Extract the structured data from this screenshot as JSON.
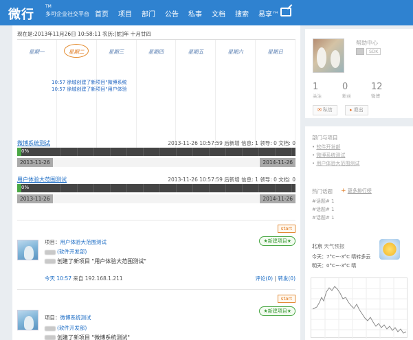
{
  "header": {
    "logo": "微行",
    "logo_tm": "TM",
    "logo_sub": "多可企业社交平台",
    "nav": [
      "首页",
      "项目",
      "部门",
      "公告",
      "私事",
      "文档",
      "搜索",
      "易享™"
    ]
  },
  "calendar": {
    "current_time": "现在是:2013年11月26日 10:58:11 农历:[蛇]年 十月廿四",
    "days": [
      "星期一",
      "星期二",
      "星期三",
      "星期四",
      "星期五",
      "星期六",
      "星期日"
    ],
    "active_index": 1,
    "events": [
      "10:57 徐城创建了新项目\"微博系统测试\"",
      "10:57 徐城创建了新项目\"用户体验大范围测试\""
    ]
  },
  "projects": [
    {
      "name": "微博系统测试",
      "info": "2013-11-26 10:57:59 后新增 信息: 1 领导: 0 文档: 0",
      "progress_label": "0%",
      "progress": 0.01,
      "start_date": "2013-11-26",
      "end_date": "2014-11-26"
    },
    {
      "name": "用户体验大范围测试",
      "info": "2013-11-26 10:57:59 后新增 信息: 1 领导: 0 文档: 0",
      "progress_label": "0%",
      "progress": 0.01,
      "start_date": "2013-11-26",
      "end_date": "2014-11-26"
    }
  ],
  "feed": [
    {
      "tag_start": "start",
      "tag_new": "★新建项目★",
      "project_label": "项目：",
      "project_name": "用户体验大范围测试",
      "dept": "(软件开发部)",
      "text": "创建了新项目 \"用户体验大范围测试\"",
      "time": "今天 10:57",
      "from": "来自 192.168.1.211",
      "comment": "评论(0)",
      "forward": "转发(0)"
    },
    {
      "tag_start": "start",
      "tag_new": "★新建项目★",
      "project_label": "项目：",
      "project_name": "微博系统测试",
      "dept": "(软件开发部)",
      "text": "创建了新项目 \"微博系统测试\""
    }
  ],
  "profile": {
    "name": "帮助中心",
    "badge": "SDK",
    "stats": [
      {
        "n": "1",
        "label": "关注"
      },
      {
        "n": "0",
        "label": "粉丝"
      },
      {
        "n": "12",
        "label": "微博"
      }
    ],
    "btn_msg": "私信",
    "btn_logout": "退出"
  },
  "depts": {
    "title": "部门与项目",
    "items": [
      "软件开发部",
      "微博系统测试",
      "用户体验大范围测试"
    ]
  },
  "hot": {
    "title": "热门话题",
    "more": "更多排行榜",
    "items": [
      "#话题#",
      "#话题#",
      "#话题#"
    ],
    "counts": [
      "1",
      "1",
      "1"
    ]
  },
  "weather": {
    "city": "北京",
    "label": "天气预报",
    "today": "今天：7°C~-3°C 晴转多云",
    "tomorrow": "明天：0°C~-3°C 晴"
  }
}
